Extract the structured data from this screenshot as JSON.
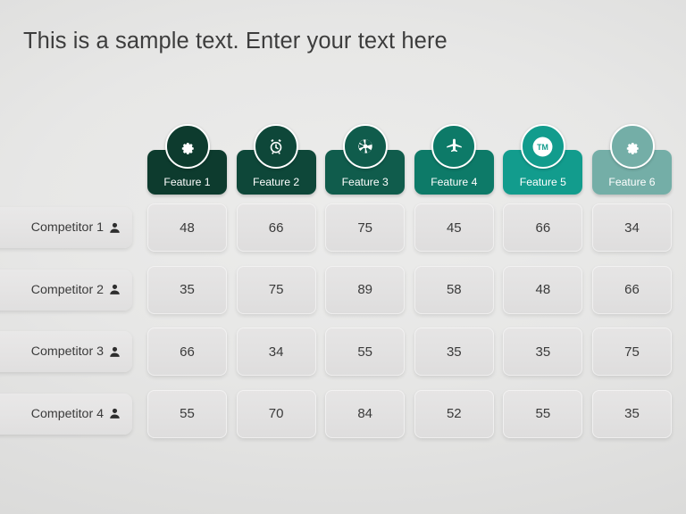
{
  "title": "This is a sample text. Enter your text here",
  "theme": {
    "background": "#e4e4e3",
    "text_dark": "#3a3a3a",
    "cell_fill": "#e3e2e2",
    "label_fill": "#e5e4e4"
  },
  "chart_data": {
    "type": "table",
    "title": "This is a sample text. Enter your text here",
    "xlabel": "",
    "ylabel": "",
    "categories": [
      "Feature 1",
      "Feature 2",
      "Feature 3",
      "Feature 4",
      "Feature 5",
      "Feature 6"
    ],
    "row_labels": [
      "Competitor 1",
      "Competitor 2",
      "Competitor 3",
      "Competitor 4"
    ],
    "series": [
      {
        "name": "Competitor 1",
        "values": [
          48,
          66,
          75,
          45,
          66,
          34
        ]
      },
      {
        "name": "Competitor 2",
        "values": [
          35,
          75,
          89,
          58,
          48,
          66
        ]
      },
      {
        "name": "Competitor 3",
        "values": [
          66,
          34,
          55,
          35,
          35,
          75
        ]
      },
      {
        "name": "Competitor 4",
        "values": [
          55,
          70,
          84,
          52,
          55,
          35
        ]
      }
    ],
    "values": [
      [
        48,
        66,
        75,
        45,
        66,
        34
      ],
      [
        35,
        75,
        89,
        58,
        48,
        66
      ],
      [
        66,
        34,
        55,
        35,
        35,
        75
      ],
      [
        55,
        70,
        84,
        52,
        55,
        35
      ]
    ],
    "grid": false,
    "legend": "none"
  },
  "columns": [
    {
      "label": "Feature 1",
      "icon": "gear-icon",
      "color": "#0d3b2e"
    },
    {
      "label": "Feature 2",
      "icon": "alarm-icon",
      "color": "#0e4739"
    },
    {
      "label": "Feature 3",
      "icon": "aperture-icon",
      "color": "#105c4c"
    },
    {
      "label": "Feature 4",
      "icon": "airplane-icon",
      "color": "#0d7a68"
    },
    {
      "label": "Feature 5",
      "icon": "tm-icon",
      "color": "#129c8d"
    },
    {
      "label": "Feature 6",
      "icon": "gear-icon",
      "color": "#74aea7"
    }
  ],
  "rows": [
    {
      "label": "Competitor 1",
      "icon": "person-icon",
      "values": [
        "48",
        "66",
        "75",
        "45",
        "66",
        "34"
      ]
    },
    {
      "label": "Competitor 2",
      "icon": "person-icon",
      "values": [
        "35",
        "75",
        "89",
        "58",
        "48",
        "66"
      ]
    },
    {
      "label": "Competitor 3",
      "icon": "person-icon",
      "values": [
        "66",
        "34",
        "55",
        "35",
        "35",
        "75"
      ]
    },
    {
      "label": "Competitor 4",
      "icon": "person-icon",
      "values": [
        "55",
        "70",
        "84",
        "52",
        "55",
        "35"
      ]
    }
  ]
}
